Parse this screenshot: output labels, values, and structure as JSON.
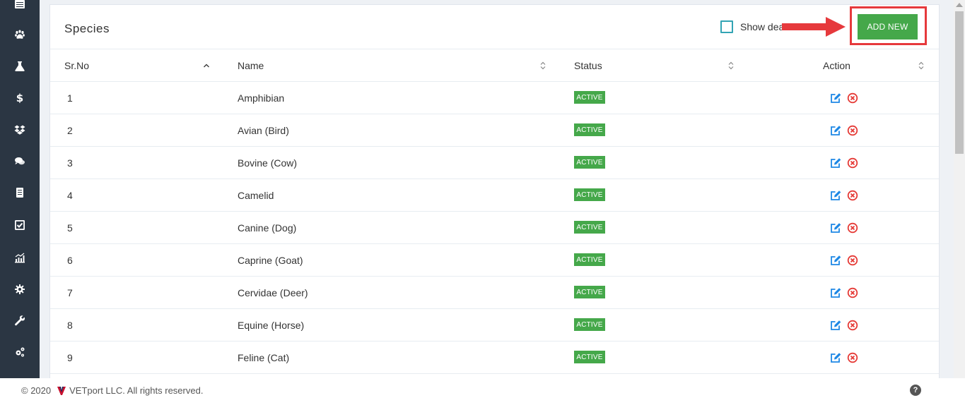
{
  "panel": {
    "title": "Species"
  },
  "filter": {
    "show_deactivated_label": "Show deactivated"
  },
  "toolbar": {
    "add_new_label": "ADD NEW"
  },
  "table": {
    "columns": [
      "Sr.No",
      "Name",
      "Status",
      "Action"
    ],
    "rows": [
      {
        "sr": "1",
        "name": "Amphibian",
        "status": "ACTIVE"
      },
      {
        "sr": "2",
        "name": "Avian (Bird)",
        "status": "ACTIVE"
      },
      {
        "sr": "3",
        "name": "Bovine (Cow)",
        "status": "ACTIVE"
      },
      {
        "sr": "4",
        "name": "Camelid",
        "status": "ACTIVE"
      },
      {
        "sr": "5",
        "name": "Canine (Dog)",
        "status": "ACTIVE"
      },
      {
        "sr": "6",
        "name": "Caprine (Goat)",
        "status": "ACTIVE"
      },
      {
        "sr": "7",
        "name": "Cervidae (Deer)",
        "status": "ACTIVE"
      },
      {
        "sr": "8",
        "name": "Equine (Horse)",
        "status": "ACTIVE"
      },
      {
        "sr": "9",
        "name": "Feline (Cat)",
        "status": "ACTIVE"
      }
    ]
  },
  "sidebar": {
    "icons": [
      "table-icon",
      "paw-icon",
      "flask-icon",
      "dollar-icon",
      "dropbox-icon",
      "comments-icon",
      "document-icon",
      "checkbox-icon",
      "chart-icon",
      "gear-icon",
      "wrench-icon",
      "gears-icon"
    ]
  },
  "footer": {
    "copyright": "© 2020",
    "company": "VETport LLC. All rights reserved.",
    "help": "?"
  },
  "colors": {
    "sidebar": "#2b3643",
    "accent_green": "#45a84a",
    "highlight_red": "#e6393c",
    "edit_blue": "#1e88e5",
    "delete_red": "#e53935",
    "checkbox_teal": "#32a4b4"
  }
}
